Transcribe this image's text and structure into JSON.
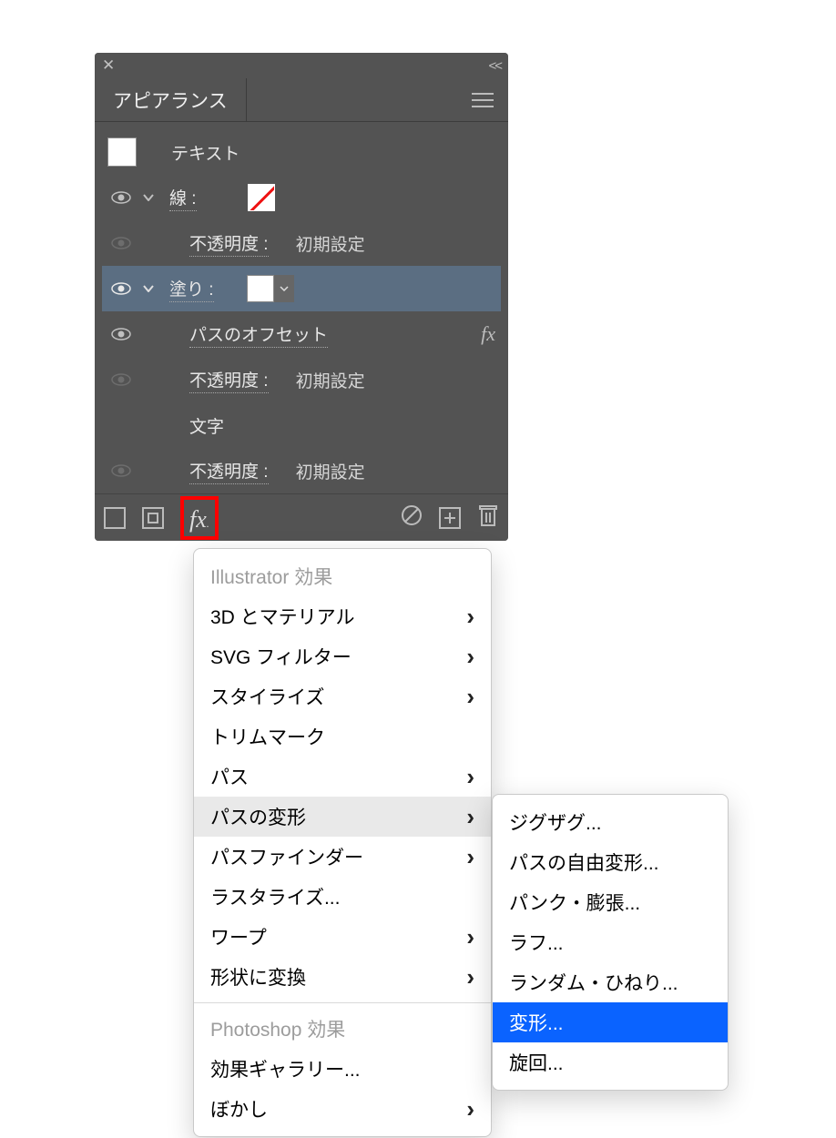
{
  "panel": {
    "tab_label": "アピアランス",
    "object_type": "テキスト",
    "stroke_label": "線 :",
    "opacity_label": "不透明度 :",
    "opacity_value": "初期設定",
    "fill_label": "塗り :",
    "offset_label": "パスのオフセット",
    "characters_label": "文字"
  },
  "menu_main": {
    "header1": "Illustrator 効果",
    "items1": [
      {
        "label": "3D とマテリアル",
        "sub": true
      },
      {
        "label": "SVG フィルター",
        "sub": true
      },
      {
        "label": "スタイライズ",
        "sub": true
      },
      {
        "label": "トリムマーク",
        "sub": false
      },
      {
        "label": "パス",
        "sub": true
      },
      {
        "label": "パスの変形",
        "sub": true,
        "hover": true
      },
      {
        "label": "パスファインダー",
        "sub": true
      },
      {
        "label": "ラスタライズ...",
        "sub": false
      },
      {
        "label": "ワープ",
        "sub": true
      },
      {
        "label": "形状に変換",
        "sub": true
      }
    ],
    "header2": "Photoshop 効果",
    "items2": [
      {
        "label": "効果ギャラリー...",
        "sub": false
      },
      {
        "label": "ぼかし",
        "sub": true
      }
    ]
  },
  "menu_sub": {
    "items": [
      {
        "label": "ジグザグ..."
      },
      {
        "label": "パスの自由変形..."
      },
      {
        "label": "パンク・膨張..."
      },
      {
        "label": "ラフ..."
      },
      {
        "label": "ランダム・ひねり..."
      },
      {
        "label": "変形...",
        "sel": true
      },
      {
        "label": "旋回..."
      }
    ]
  }
}
